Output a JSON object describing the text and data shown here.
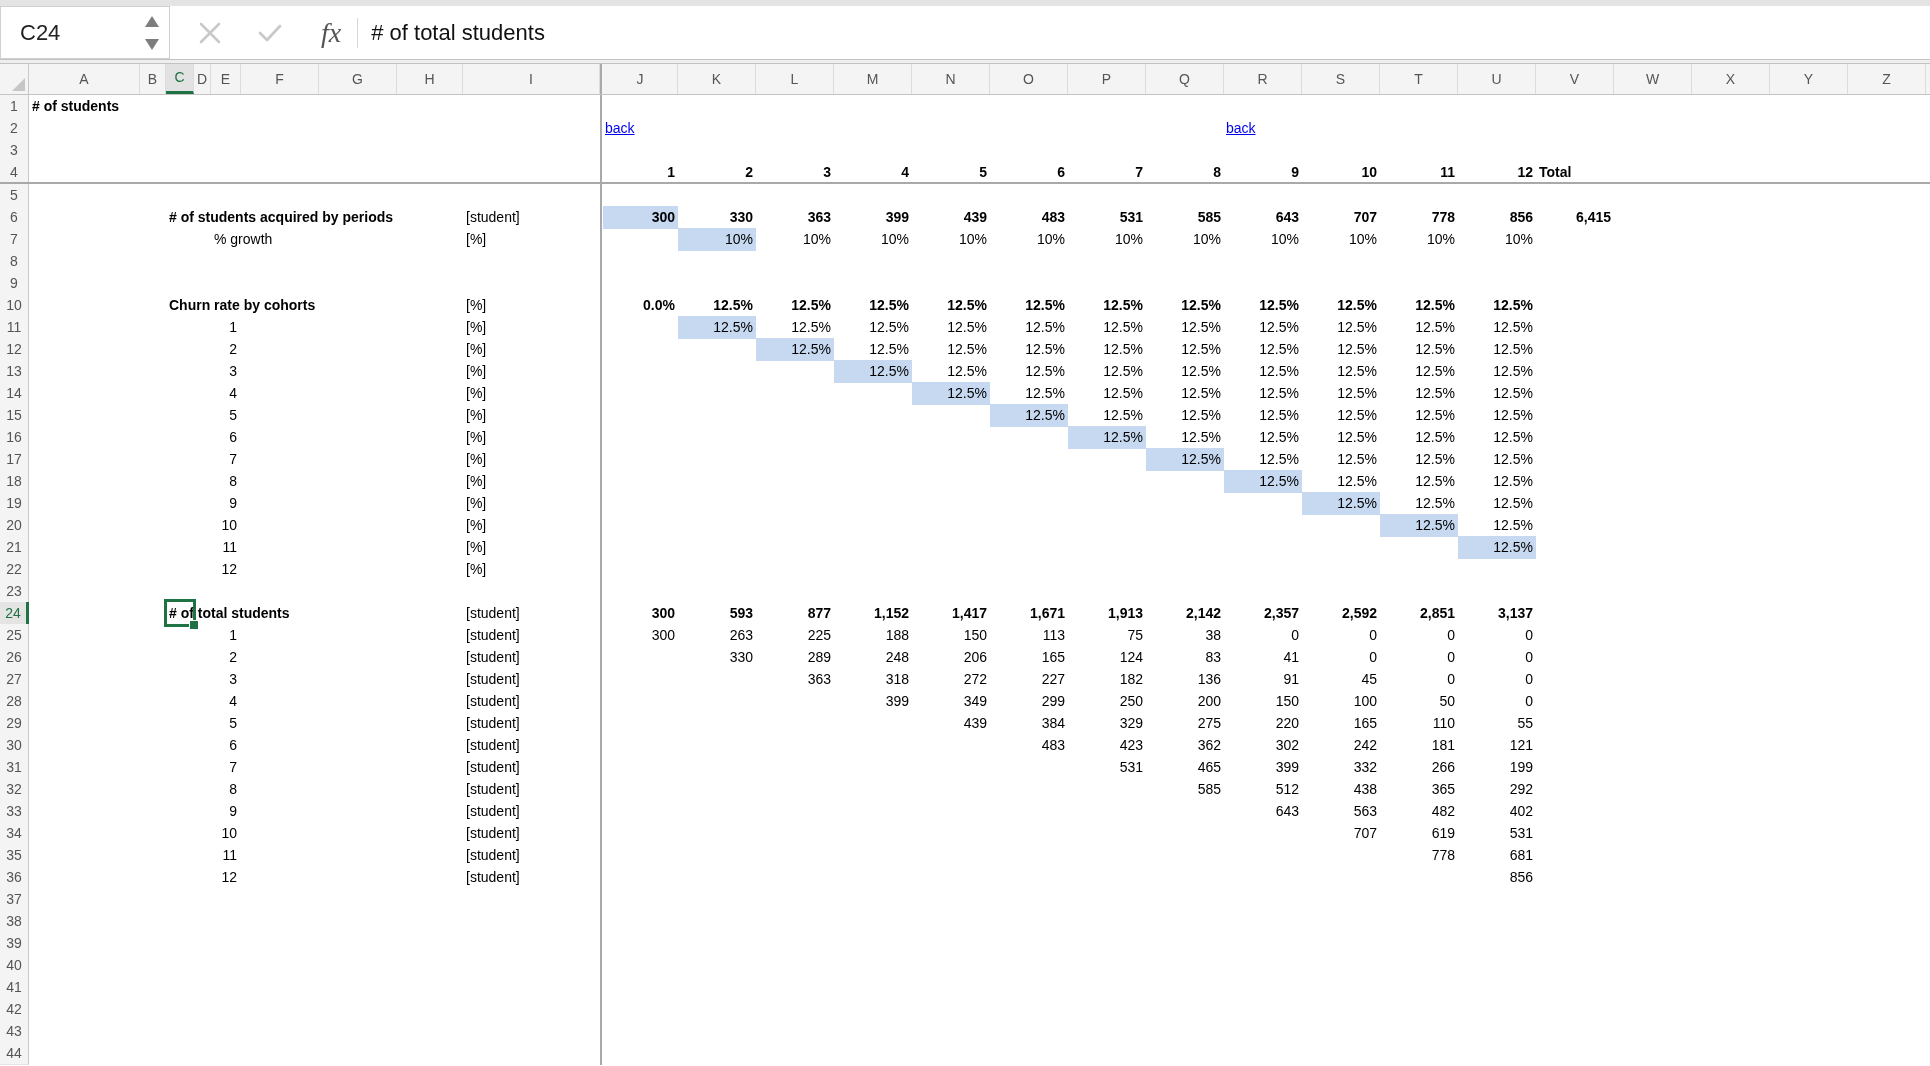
{
  "formula_bar": {
    "name_box": "C24",
    "cancel": {
      "disabled": true
    },
    "enter": {
      "disabled": true
    },
    "function_label": "fx",
    "formula": "# of total students"
  },
  "column_headers": [
    {
      "label": "A",
      "selected": false
    },
    {
      "label": "B",
      "selected": false
    },
    {
      "label": "C",
      "selected": true
    },
    {
      "label": "D",
      "selected": false
    },
    {
      "label": "E",
      "selected": false
    },
    {
      "label": "F",
      "selected": false
    },
    {
      "label": "G",
      "selected": false
    },
    {
      "label": "H",
      "selected": false
    },
    {
      "label": "I",
      "selected": false
    },
    {
      "label": "J",
      "selected": false
    },
    {
      "label": "K",
      "selected": false
    },
    {
      "label": "L",
      "selected": false
    },
    {
      "label": "M",
      "selected": false
    },
    {
      "label": "N",
      "selected": false
    },
    {
      "label": "O",
      "selected": false
    },
    {
      "label": "P",
      "selected": false
    },
    {
      "label": "Q",
      "selected": false
    },
    {
      "label": "R",
      "selected": false
    },
    {
      "label": "S",
      "selected": false
    },
    {
      "label": "T",
      "selected": false
    },
    {
      "label": "U",
      "selected": false
    },
    {
      "label": "V",
      "selected": false
    },
    {
      "label": "W",
      "selected": false
    },
    {
      "label": "X",
      "selected": false
    },
    {
      "label": "Y",
      "selected": false
    },
    {
      "label": "Z",
      "selected": false
    }
  ],
  "rows": [
    {
      "number": "1",
      "selected": false,
      "kind": "title",
      "label": "# of students"
    },
    {
      "number": "2",
      "selected": false,
      "kind": "links",
      "links": [
        {
          "text": "back"
        },
        {
          "text": "back"
        }
      ]
    },
    {
      "number": "3",
      "selected": false
    },
    {
      "number": "4",
      "selected": false,
      "kind": "periods",
      "values": [
        {
          "text": "1"
        },
        {
          "text": "2"
        },
        {
          "text": "3"
        },
        {
          "text": "4"
        },
        {
          "text": "5"
        },
        {
          "text": "6"
        },
        {
          "text": "7"
        },
        {
          "text": "8"
        },
        {
          "text": "9"
        },
        {
          "text": "10"
        },
        {
          "text": "11"
        },
        {
          "text": "12"
        }
      ],
      "total": "Total"
    },
    {
      "number": "5",
      "selected": false
    },
    {
      "number": "6",
      "selected": false,
      "kind": "heading",
      "label": "# of students acquired by periods",
      "unit": "[student]",
      "values": [
        {
          "text": "300",
          "highlighted": true
        },
        {
          "text": "330",
          "highlighted": false
        },
        {
          "text": "363",
          "highlighted": false
        },
        {
          "text": "399",
          "highlighted": false
        },
        {
          "text": "439",
          "highlighted": false
        },
        {
          "text": "483",
          "highlighted": false
        },
        {
          "text": "531",
          "highlighted": false
        },
        {
          "text": "585",
          "highlighted": false
        },
        {
          "text": "643",
          "highlighted": false
        },
        {
          "text": "707",
          "highlighted": false
        },
        {
          "text": "778",
          "highlighted": false
        },
        {
          "text": "856",
          "highlighted": false
        }
      ],
      "total": "6,415"
    },
    {
      "number": "7",
      "selected": false,
      "kind": "subrow",
      "label": "% growth",
      "unit": "[%]",
      "values": [
        {
          "text": "10%",
          "highlighted": true
        },
        {
          "text": "10%",
          "highlighted": false
        },
        {
          "text": "10%",
          "highlighted": false
        },
        {
          "text": "10%",
          "highlighted": false
        },
        {
          "text": "10%",
          "highlighted": false
        },
        {
          "text": "10%",
          "highlighted": false
        },
        {
          "text": "10%",
          "highlighted": false
        },
        {
          "text": "10%",
          "highlighted": false
        },
        {
          "text": "10%",
          "highlighted": false
        },
        {
          "text": "10%",
          "highlighted": false
        },
        {
          "text": "10%",
          "highlighted": false
        }
      ]
    },
    {
      "number": "8",
      "selected": false
    },
    {
      "number": "9",
      "selected": false
    },
    {
      "number": "10",
      "selected": false,
      "kind": "heading",
      "label": "Churn rate by cohorts",
      "unit": "[%]",
      "values": [
        {
          "text": "0.0%",
          "highlighted": false
        },
        {
          "text": "12.5%",
          "highlighted": false
        },
        {
          "text": "12.5%",
          "highlighted": false
        },
        {
          "text": "12.5%",
          "highlighted": false
        },
        {
          "text": "12.5%",
          "highlighted": false
        },
        {
          "text": "12.5%",
          "highlighted": false
        },
        {
          "text": "12.5%",
          "highlighted": false
        },
        {
          "text": "12.5%",
          "highlighted": false
        },
        {
          "text": "12.5%",
          "highlighted": false
        },
        {
          "text": "12.5%",
          "highlighted": false
        },
        {
          "text": "12.5%",
          "highlighted": false
        },
        {
          "text": "12.5%",
          "highlighted": false
        }
      ]
    },
    {
      "number": "11",
      "selected": false,
      "kind": "cohort",
      "label": "1",
      "unit": "[%]",
      "values": [
        {
          "text": "12.5%",
          "highlighted": true
        },
        {
          "text": "12.5%",
          "highlighted": false
        },
        {
          "text": "12.5%",
          "highlighted": false
        },
        {
          "text": "12.5%",
          "highlighted": false
        },
        {
          "text": "12.5%",
          "highlighted": false
        },
        {
          "text": "12.5%",
          "highlighted": false
        },
        {
          "text": "12.5%",
          "highlighted": false
        },
        {
          "text": "12.5%",
          "highlighted": false
        },
        {
          "text": "12.5%",
          "highlighted": false
        },
        {
          "text": "12.5%",
          "highlighted": false
        },
        {
          "text": "12.5%",
          "highlighted": false
        }
      ]
    },
    {
      "number": "12",
      "selected": false,
      "kind": "cohort",
      "label": "2",
      "unit": "[%]",
      "values": [
        {
          "text": "12.5%",
          "highlighted": true
        },
        {
          "text": "12.5%",
          "highlighted": false
        },
        {
          "text": "12.5%",
          "highlighted": false
        },
        {
          "text": "12.5%",
          "highlighted": false
        },
        {
          "text": "12.5%",
          "highlighted": false
        },
        {
          "text": "12.5%",
          "highlighted": false
        },
        {
          "text": "12.5%",
          "highlighted": false
        },
        {
          "text": "12.5%",
          "highlighted": false
        },
        {
          "text": "12.5%",
          "highlighted": false
        },
        {
          "text": "12.5%",
          "highlighted": false
        }
      ]
    },
    {
      "number": "13",
      "selected": false,
      "kind": "cohort",
      "label": "3",
      "unit": "[%]",
      "values": [
        {
          "text": "12.5%",
          "highlighted": true
        },
        {
          "text": "12.5%",
          "highlighted": false
        },
        {
          "text": "12.5%",
          "highlighted": false
        },
        {
          "text": "12.5%",
          "highlighted": false
        },
        {
          "text": "12.5%",
          "highlighted": false
        },
        {
          "text": "12.5%",
          "highlighted": false
        },
        {
          "text": "12.5%",
          "highlighted": false
        },
        {
          "text": "12.5%",
          "highlighted": false
        },
        {
          "text": "12.5%",
          "highlighted": false
        }
      ]
    },
    {
      "number": "14",
      "selected": false,
      "kind": "cohort",
      "label": "4",
      "unit": "[%]",
      "values": [
        {
          "text": "12.5%",
          "highlighted": true
        },
        {
          "text": "12.5%",
          "highlighted": false
        },
        {
          "text": "12.5%",
          "highlighted": false
        },
        {
          "text": "12.5%",
          "highlighted": false
        },
        {
          "text": "12.5%",
          "highlighted": false
        },
        {
          "text": "12.5%",
          "highlighted": false
        },
        {
          "text": "12.5%",
          "highlighted": false
        },
        {
          "text": "12.5%",
          "highlighted": false
        }
      ]
    },
    {
      "number": "15",
      "selected": false,
      "kind": "cohort",
      "label": "5",
      "unit": "[%]",
      "values": [
        {
          "text": "12.5%",
          "highlighted": true
        },
        {
          "text": "12.5%",
          "highlighted": false
        },
        {
          "text": "12.5%",
          "highlighted": false
        },
        {
          "text": "12.5%",
          "highlighted": false
        },
        {
          "text": "12.5%",
          "highlighted": false
        },
        {
          "text": "12.5%",
          "highlighted": false
        },
        {
          "text": "12.5%",
          "highlighted": false
        }
      ]
    },
    {
      "number": "16",
      "selected": false,
      "kind": "cohort",
      "label": "6",
      "unit": "[%]",
      "values": [
        {
          "text": "12.5%",
          "highlighted": true
        },
        {
          "text": "12.5%",
          "highlighted": false
        },
        {
          "text": "12.5%",
          "highlighted": false
        },
        {
          "text": "12.5%",
          "highlighted": false
        },
        {
          "text": "12.5%",
          "highlighted": false
        },
        {
          "text": "12.5%",
          "highlighted": false
        }
      ]
    },
    {
      "number": "17",
      "selected": false,
      "kind": "cohort",
      "label": "7",
      "unit": "[%]",
      "values": [
        {
          "text": "12.5%",
          "highlighted": true
        },
        {
          "text": "12.5%",
          "highlighted": false
        },
        {
          "text": "12.5%",
          "highlighted": false
        },
        {
          "text": "12.5%",
          "highlighted": false
        },
        {
          "text": "12.5%",
          "highlighted": false
        }
      ]
    },
    {
      "number": "18",
      "selected": false,
      "kind": "cohort",
      "label": "8",
      "unit": "[%]",
      "values": [
        {
          "text": "12.5%",
          "highlighted": true
        },
        {
          "text": "12.5%",
          "highlighted": false
        },
        {
          "text": "12.5%",
          "highlighted": false
        },
        {
          "text": "12.5%",
          "highlighted": false
        }
      ]
    },
    {
      "number": "19",
      "selected": false,
      "kind": "cohort",
      "label": "9",
      "unit": "[%]",
      "values": [
        {
          "text": "12.5%",
          "highlighted": true
        },
        {
          "text": "12.5%",
          "highlighted": false
        },
        {
          "text": "12.5%",
          "highlighted": false
        }
      ]
    },
    {
      "number": "20",
      "selected": false,
      "kind": "cohort",
      "label": "10",
      "unit": "[%]",
      "values": [
        {
          "text": "12.5%",
          "highlighted": true
        },
        {
          "text": "12.5%",
          "highlighted": false
        }
      ]
    },
    {
      "number": "21",
      "selected": false,
      "kind": "cohort",
      "label": "11",
      "unit": "[%]",
      "values": [
        {
          "text": "12.5%",
          "highlighted": true
        }
      ]
    },
    {
      "number": "22",
      "selected": false,
      "kind": "cohort",
      "label": "12",
      "unit": "[%]"
    },
    {
      "number": "23",
      "selected": false
    },
    {
      "number": "24",
      "selected": true,
      "kind": "heading",
      "label": "# of total students",
      "unit": "[student]",
      "values": [
        {
          "text": "300"
        },
        {
          "text": "593"
        },
        {
          "text": "877"
        },
        {
          "text": "1,152"
        },
        {
          "text": "1,417"
        },
        {
          "text": "1,671"
        },
        {
          "text": "1,913"
        },
        {
          "text": "2,142"
        },
        {
          "text": "2,357"
        },
        {
          "text": "2,592"
        },
        {
          "text": "2,851"
        },
        {
          "text": "3,137"
        }
      ]
    },
    {
      "number": "25",
      "selected": false,
      "kind": "cohort",
      "label": "1",
      "unit": "[student]",
      "values": [
        {
          "text": "300"
        },
        {
          "text": "263"
        },
        {
          "text": "225"
        },
        {
          "text": "188"
        },
        {
          "text": "150"
        },
        {
          "text": "113"
        },
        {
          "text": "75"
        },
        {
          "text": "38"
        },
        {
          "text": "0"
        },
        {
          "text": "0"
        },
        {
          "text": "0"
        },
        {
          "text": "0"
        }
      ]
    },
    {
      "number": "26",
      "selected": false,
      "kind": "cohort",
      "label": "2",
      "unit": "[student]",
      "values": [
        {
          "text": "330"
        },
        {
          "text": "289"
        },
        {
          "text": "248"
        },
        {
          "text": "206"
        },
        {
          "text": "165"
        },
        {
          "text": "124"
        },
        {
          "text": "83"
        },
        {
          "text": "41"
        },
        {
          "text": "0"
        },
        {
          "text": "0"
        },
        {
          "text": "0"
        }
      ]
    },
    {
      "number": "27",
      "selected": false,
      "kind": "cohort",
      "label": "3",
      "unit": "[student]",
      "values": [
        {
          "text": "363"
        },
        {
          "text": "318"
        },
        {
          "text": "272"
        },
        {
          "text": "227"
        },
        {
          "text": "182"
        },
        {
          "text": "136"
        },
        {
          "text": "91"
        },
        {
          "text": "45"
        },
        {
          "text": "0"
        },
        {
          "text": "0"
        }
      ]
    },
    {
      "number": "28",
      "selected": false,
      "kind": "cohort",
      "label": "4",
      "unit": "[student]",
      "values": [
        {
          "text": "399"
        },
        {
          "text": "349"
        },
        {
          "text": "299"
        },
        {
          "text": "250"
        },
        {
          "text": "200"
        },
        {
          "text": "150"
        },
        {
          "text": "100"
        },
        {
          "text": "50"
        },
        {
          "text": "0"
        }
      ]
    },
    {
      "number": "29",
      "selected": false,
      "kind": "cohort",
      "label": "5",
      "unit": "[student]",
      "values": [
        {
          "text": "439"
        },
        {
          "text": "384"
        },
        {
          "text": "329"
        },
        {
          "text": "275"
        },
        {
          "text": "220"
        },
        {
          "text": "165"
        },
        {
          "text": "110"
        },
        {
          "text": "55"
        }
      ]
    },
    {
      "number": "30",
      "selected": false,
      "kind": "cohort",
      "label": "6",
      "unit": "[student]",
      "values": [
        {
          "text": "483"
        },
        {
          "text": "423"
        },
        {
          "text": "362"
        },
        {
          "text": "302"
        },
        {
          "text": "242"
        },
        {
          "text": "181"
        },
        {
          "text": "121"
        }
      ]
    },
    {
      "number": "31",
      "selected": false,
      "kind": "cohort",
      "label": "7",
      "unit": "[student]",
      "values": [
        {
          "text": "531"
        },
        {
          "text": "465"
        },
        {
          "text": "399"
        },
        {
          "text": "332"
        },
        {
          "text": "266"
        },
        {
          "text": "199"
        }
      ]
    },
    {
      "number": "32",
      "selected": false,
      "kind": "cohort",
      "label": "8",
      "unit": "[student]",
      "values": [
        {
          "text": "585"
        },
        {
          "text": "512"
        },
        {
          "text": "438"
        },
        {
          "text": "365"
        },
        {
          "text": "292"
        }
      ]
    },
    {
      "number": "33",
      "selected": false,
      "kind": "cohort",
      "label": "9",
      "unit": "[student]",
      "values": [
        {
          "text": "643"
        },
        {
          "text": "563"
        },
        {
          "text": "482"
        },
        {
          "text": "402"
        }
      ]
    },
    {
      "number": "34",
      "selected": false,
      "kind": "cohort",
      "label": "10",
      "unit": "[student]",
      "values": [
        {
          "text": "707"
        },
        {
          "text": "619"
        },
        {
          "text": "531"
        }
      ]
    },
    {
      "number": "35",
      "selected": false,
      "kind": "cohort",
      "label": "11",
      "unit": "[student]",
      "values": [
        {
          "text": "778"
        },
        {
          "text": "681"
        }
      ]
    },
    {
      "number": "36",
      "selected": false,
      "kind": "cohort",
      "label": "12",
      "unit": "[student]",
      "values": [
        {
          "text": "856"
        }
      ]
    },
    {
      "number": "37",
      "selected": false
    },
    {
      "number": "38",
      "selected": false
    },
    {
      "number": "39",
      "selected": false
    },
    {
      "number": "40",
      "selected": false
    },
    {
      "number": "41",
      "selected": false
    },
    {
      "number": "42",
      "selected": false
    },
    {
      "number": "43",
      "selected": false
    },
    {
      "number": "44",
      "selected": false
    }
  ]
}
